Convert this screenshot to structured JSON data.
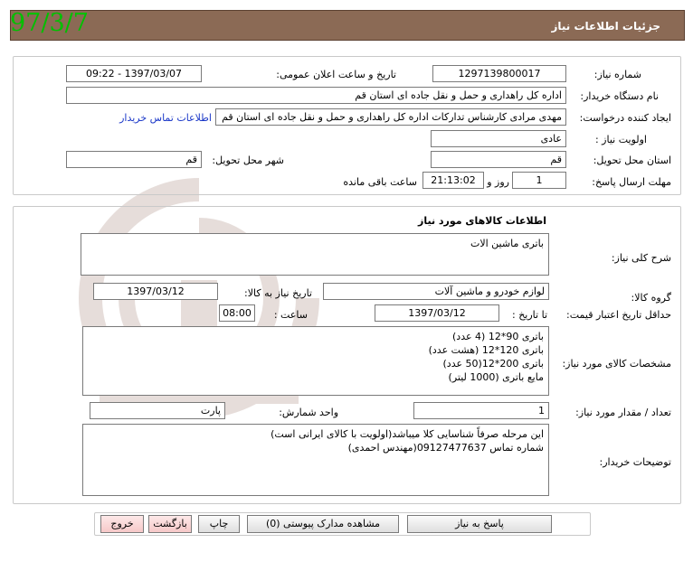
{
  "header": {
    "title": "جزئیات اطلاعات نیاز",
    "date_stamp": "97/3/7",
    "bar_color": "#8b6a55",
    "stamp_color": "#00c000"
  },
  "info": {
    "need_number_label": "شماره نیاز:",
    "need_number": "1297139800017",
    "announce_label": "تاریخ و ساعت اعلان عمومی:",
    "announce_value": "1397/03/07 - 09:22",
    "buyer_label": "نام دستگاه خریدار:",
    "buyer_value": "اداره کل راهداری و حمل و نقل جاده ای استان قم",
    "creator_label": "ایجاد کننده درخواست:",
    "creator_value": "مهدی مرادی کارشناس تدارکات اداره کل راهداری و حمل و نقل جاده ای استان قم",
    "contact_link": "اطلاعات تماس خریدار",
    "priority_label": "اولویت نیاز :",
    "priority_value": "عادی",
    "province_label": "استان محل تحویل:",
    "province_value": "قم",
    "city_label": "شهر محل تحویل:",
    "city_value": "قم",
    "deadline_label": "مهلت ارسال پاسخ:",
    "deadline_days": "1",
    "days_word": "روز و",
    "deadline_time": "21:13:02",
    "remaining_text": "ساعت باقی مانده"
  },
  "goods": {
    "section_title": "اطلاعات کالاهای مورد نیاز",
    "desc_label": "شرح کلی نیاز:",
    "desc_value": "باتری ماشین الات",
    "group_label": "گروه کالا:",
    "group_value": "لوازم خودرو و ماشین آلات",
    "need_date_label": "تاریخ نیاز به کالا:",
    "need_date_value": "1397/03/12",
    "validity_label": "حداقل تاریخ اعتبار قیمت:",
    "until_date_label": "تا تاریخ :",
    "until_date_value": "1397/03/12",
    "hour_label": "ساعت :",
    "hour_value": "08:00",
    "specs_label": "مشخصات کالای مورد نیاز:",
    "specs_lines": [
      "باتری 90*12 (4 عدد)",
      "باتری 120*12 (هشت عدد)",
      "باتری 200*12(50 عدد)",
      "مایع باتری (1000 لیتر)"
    ],
    "qty_label": "تعداد / مقدار مورد نیاز:",
    "qty_value": "1",
    "unit_label": "واحد شمارش:",
    "unit_value": "پارت",
    "buyer_notes_label": "توضیحات خریدار:",
    "buyer_notes_lines": [
      "این مرحله صرفاً شناسایی کلا میباشد(اولویت با کالای ایرانی است)",
      "شماره تماس 09127477637(مهندس احمدی)"
    ]
  },
  "buttons": {
    "reply": "پاسخ به نیاز",
    "attachments": "مشاهده مدارک پیوستی (0)",
    "print": "چاپ",
    "back": "بازگشت",
    "exit": "خروج"
  }
}
